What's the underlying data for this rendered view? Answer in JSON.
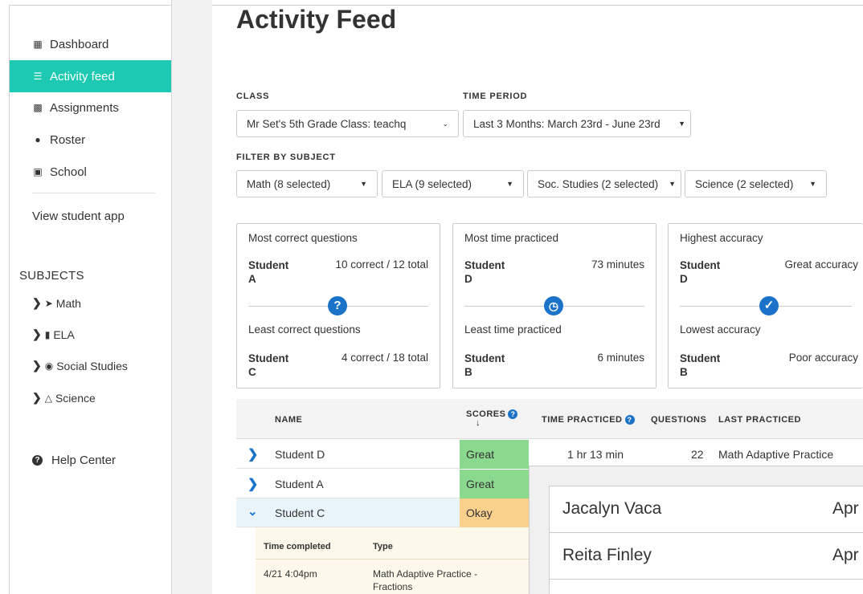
{
  "sidebar": {
    "items": [
      {
        "label": "Dashboard",
        "icon": "map-icon"
      },
      {
        "label": "Activity feed",
        "icon": "list-icon"
      },
      {
        "label": "Assignments",
        "icon": "briefcase-icon"
      },
      {
        "label": "Roster",
        "icon": "users-icon"
      },
      {
        "label": "School",
        "icon": "school-icon"
      }
    ],
    "view_student_app": "View student app",
    "subjects_title": "SUBJECTS",
    "subjects": [
      {
        "label": "Math",
        "icon": "rocket-icon"
      },
      {
        "label": "ELA",
        "icon": "book-icon"
      },
      {
        "label": "Social Studies",
        "icon": "globe-icon"
      },
      {
        "label": "Science",
        "icon": "flask-icon"
      }
    ],
    "help_center": "Help Center"
  },
  "main": {
    "title": "Activity Feed",
    "class_label": "CLASS",
    "class_value": "Mr Set's 5th Grade Class: teachq",
    "time_period_label": "TIME PERIOD",
    "time_period_value": "Last 3 Months: March 23rd - June 23rd",
    "filter_label": "FILTER BY SUBJECT",
    "filters": [
      "Math (8 selected)",
      "ELA (9 selected)",
      "Soc. Studies (2 selected)",
      "Science (2 selected)"
    ]
  },
  "cards": [
    {
      "top_title": "Most correct questions",
      "top_student": "Student A",
      "top_value": "10 correct / 12 total",
      "icon": "question-icon",
      "bottom_title": "Least correct questions",
      "bottom_student": "Student C",
      "bottom_value": "4 correct / 18 total"
    },
    {
      "top_title": "Most time practiced",
      "top_student": "Student D",
      "top_value": "73 minutes",
      "icon": "clock-icon",
      "bottom_title": "Least time practiced",
      "bottom_student": "Student B",
      "bottom_value": "6 minutes"
    },
    {
      "top_title": "Highest accuracy",
      "top_student": "Student D",
      "top_value": "Great accuracy",
      "icon": "check-icon",
      "bottom_title": "Lowest accuracy",
      "bottom_student": "Student B",
      "bottom_value": "Poor accuracy"
    }
  ],
  "table": {
    "headers": {
      "name": "NAME",
      "scores": "SCORES",
      "time": "TIME PRACTICED",
      "questions": "QUESTIONS",
      "last": "LAST PRACTICED"
    },
    "rows": [
      {
        "name": "Student D",
        "score": "Great",
        "time": "1 hr 13 min",
        "questions": "22",
        "last": "Math Adaptive Practice"
      },
      {
        "name": "Student A",
        "score": "Great"
      },
      {
        "name": "Student C",
        "score": "Okay"
      }
    ],
    "detail": {
      "col1": "Time completed",
      "col2": "Type",
      "time": "4/21 4:04pm",
      "type": "Math Adaptive Practice - Fractions"
    }
  },
  "overlay": {
    "rows": [
      {
        "name": "Jacalyn Vaca",
        "date": "Apr"
      },
      {
        "name": "Reita Finley",
        "date": "Apr"
      }
    ]
  },
  "colors": {
    "accent": "#1ec9b3",
    "blue": "#1a73c8",
    "great": "#8bd88f",
    "okay": "#f9d08c"
  }
}
